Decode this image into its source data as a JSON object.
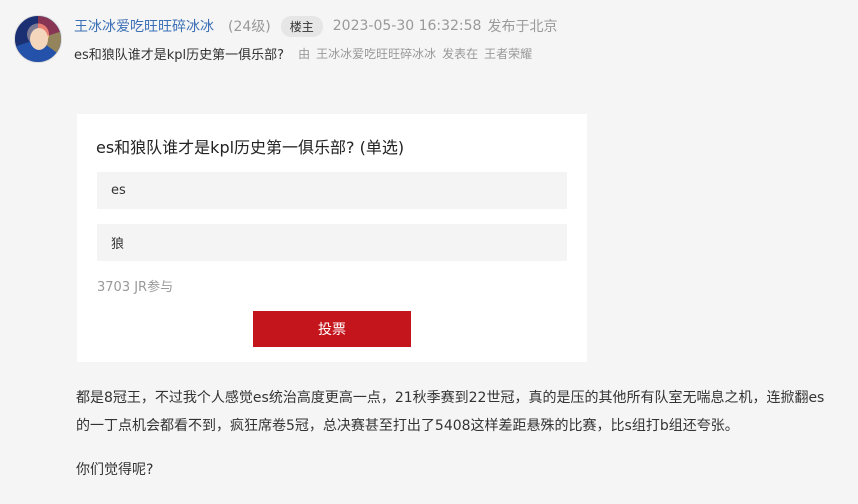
{
  "post": {
    "username": "王冰冰爱吃旺旺碎冰冰",
    "level": "(24级)",
    "floor_badge": "楼主",
    "time": "2023-05-30 16:32:58",
    "location": "发布于北京",
    "thread_title": "es和狼队谁才是kpl历史第一俱乐部?",
    "by_label": "由",
    "author_ref": "王冰冰爱吃旺旺碎冰冰",
    "action": "发表在",
    "board": "王者荣耀"
  },
  "poll": {
    "title": "es和狼队谁才是kpl历史第一俱乐部? (单选)",
    "options": [
      "es",
      "狼"
    ],
    "participants": "3703 JR参与",
    "vote_label": "投票"
  },
  "content": {
    "paragraph1": "都是8冠王，不过我个人感觉es统治高度更高一点，21秋季赛到22世冠，真的是压的其他所有队室无喘息之机，连掀翻es的一丁点机会都看不到，疯狂席卷5冠，总决赛甚至打出了5408这样差距悬殊的比赛，比s组打b组还夸张。",
    "paragraph2": "你们觉得呢?"
  }
}
